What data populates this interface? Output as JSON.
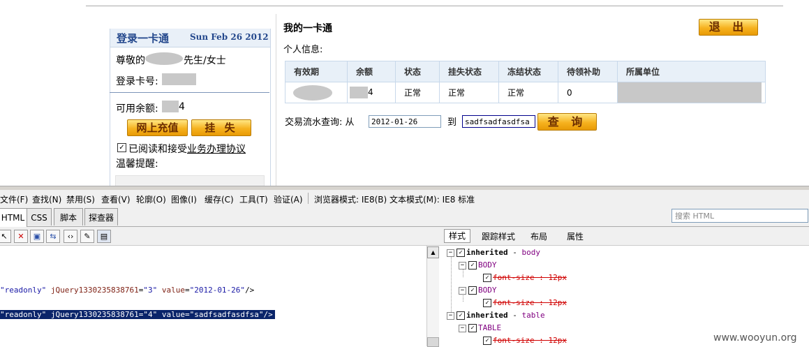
{
  "left_panel": {
    "title": "登录一卡通",
    "date": "Sun Feb 26 2012",
    "greeting_prefix": "尊敬的",
    "greeting_suffix": "先生/女士",
    "card_label": "登录卡号:",
    "balance_label": "可用余额:",
    "balance_visible": "4",
    "recharge_button": "网上充值",
    "report_loss_button": "挂 失",
    "agreement_text": "已阅读和接受业务办理协议",
    "agreement_checked": true,
    "tip_label": "温馨提醒:"
  },
  "main": {
    "title": "我的一卡通",
    "logout_button": "退 出",
    "personal_info_label": "个人信息:",
    "table": {
      "headers": [
        "有效期",
        "余额",
        "状态",
        "挂失状态",
        "冻结状态",
        "待领补助",
        "所属单位"
      ],
      "row": [
        "",
        "4",
        "正常",
        "正常",
        "正常",
        "0",
        ""
      ]
    },
    "query_label": "交易流水查询: 从",
    "query_to": "到",
    "date_from": "2012-01-26",
    "date_to": "sadfsadfasdfsa",
    "query_button": "查 询"
  },
  "devtools": {
    "menu": [
      "文件(F)",
      "查找(N)",
      "禁用(S)",
      "查看(V)",
      "轮廓(O)",
      "图像(I)",
      "缓存(C)",
      "工具(T)",
      "验证(A)",
      "浏览器模式: IE8(B)",
      "文本模式(M): IE8 标准"
    ],
    "tabs": [
      "HTML",
      "CSS",
      "脚本",
      "探查器"
    ],
    "search_placeholder": "搜索 HTML",
    "style_tabs": [
      "样式",
      "跟踪样式",
      "布局",
      "属性"
    ],
    "code_lines": [
      {
        "a1": "\"readonly\"",
        "a2": "jQuery1330235838761",
        "v2": "\"3\"",
        "a3": "value",
        "v3": "\"2012-01-26\"",
        "end": "/>"
      },
      {
        "a1": "\"readonly\"",
        "a2": "jQuery1330235838761",
        "v2": "\"4\"",
        "a3": "value",
        "v3": "\"sadfsadfasdfsa\"",
        "end": "/>"
      }
    ],
    "style_tree": {
      "inherited_body": "inherited",
      "body_sep": " - ",
      "body_word": "body",
      "body1": "BODY",
      "body2": "BODY",
      "inherited_table": "inherited",
      "table_word": "table",
      "table": "TABLE",
      "prop": "font-size : 12px"
    }
  },
  "watermark": "www.wooyun.org"
}
